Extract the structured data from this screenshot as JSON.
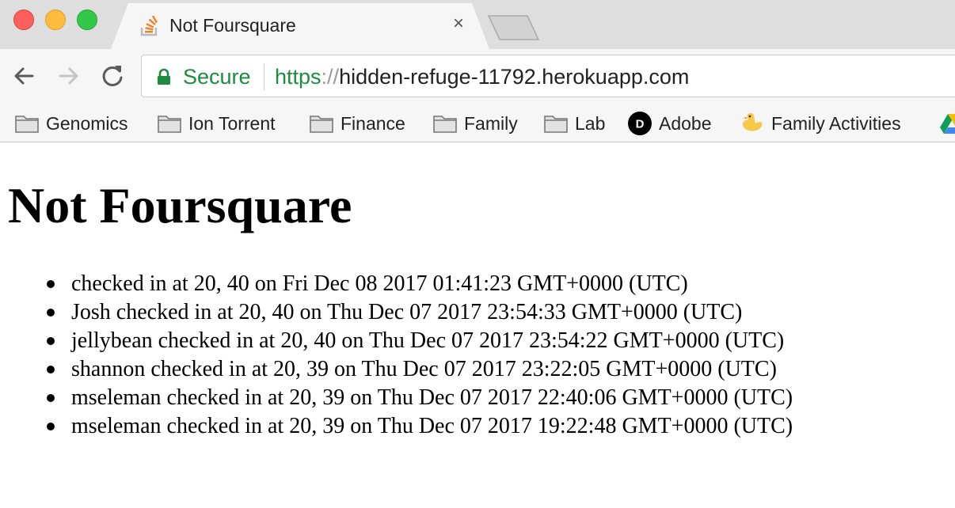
{
  "window": {
    "traffic_lights": [
      "close",
      "minimize",
      "zoom"
    ]
  },
  "tab": {
    "title": "Not Foursquare",
    "favicon": "stackoverflow-icon",
    "close_glyph": "×"
  },
  "toolbar": {
    "secure_label": "Secure",
    "url_scheme": "https",
    "url_separator": "://",
    "url_host": "hidden-refuge-11792.herokuapp.com"
  },
  "bookmarks": [
    {
      "label": "Genomics",
      "icon": "folder-icon"
    },
    {
      "label": "Ion Torrent",
      "icon": "folder-icon"
    },
    {
      "label": "Finance",
      "icon": "folder-icon"
    },
    {
      "label": "Family",
      "icon": "folder-icon"
    },
    {
      "label": "Lab",
      "icon": "folder-icon"
    },
    {
      "label": "Adobe",
      "icon": "d-circle-icon"
    },
    {
      "label": "Family Activities",
      "icon": "duck-icon"
    }
  ],
  "page": {
    "title": "Not Foursquare",
    "checkins": [
      "checked in at 20, 40 on Fri Dec 08 2017 01:41:23 GMT+0000 (UTC)",
      "Josh checked in at 20, 40 on Thu Dec 07 2017 23:54:33 GMT+0000 (UTC)",
      "jellybean checked in at 20, 40 on Thu Dec 07 2017 23:54:22 GMT+0000 (UTC)",
      "shannon checked in at 20, 39 on Thu Dec 07 2017 23:22:05 GMT+0000 (UTC)",
      "mseleman checked in at 20, 39 on Thu Dec 07 2017 22:40:06 GMT+0000 (UTC)",
      "mseleman checked in at 20, 39 on Thu Dec 07 2017 19:22:48 GMT+0000 (UTC)"
    ]
  },
  "colors": {
    "secure_green": "#1e8b3d",
    "chrome_bg": "#f6f6f6",
    "tabstrip_bg": "#dedede"
  }
}
